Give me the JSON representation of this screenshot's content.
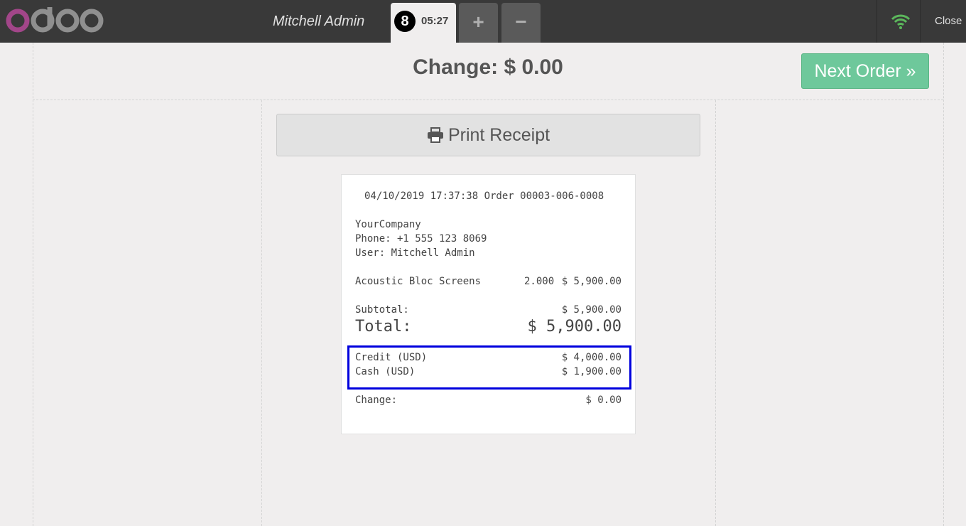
{
  "header": {
    "logo_text": "odoo",
    "cashier": "Mitchell Admin",
    "order_number": "8",
    "order_time": "05:27",
    "add_order": "+",
    "remove_order": "−",
    "close_label": "Close",
    "colors": {
      "bar": "#393939",
      "wifi": "#5cb85c",
      "logo_o": "#a24689",
      "logo_rest": "#8f8f8f"
    }
  },
  "main": {
    "change_title": "Change: $ 0.00",
    "next_order_label": "Next Order »",
    "print_receipt_label": "Print Receipt"
  },
  "receipt": {
    "header_line": "04/10/2019 17:37:38 Order 00003-006-0008",
    "company": "YourCompany",
    "phone": "Phone: +1 555 123 8069",
    "user": "User: Mitchell Admin",
    "lines": [
      {
        "product": "Acoustic Bloc Screens",
        "qty": "2.000",
        "price": "$ 5,900.00"
      }
    ],
    "subtotal_label": "Subtotal:",
    "subtotal_value": "$ 5,900.00",
    "total_label": "Total:",
    "total_value": "$ 5,900.00",
    "payments": [
      {
        "method": "Credit (USD)",
        "amount": "$ 4,000.00"
      },
      {
        "method": "Cash (USD)",
        "amount": "$ 1,900.00"
      }
    ],
    "change_label": "Change:",
    "change_value": "$ 0.00"
  }
}
